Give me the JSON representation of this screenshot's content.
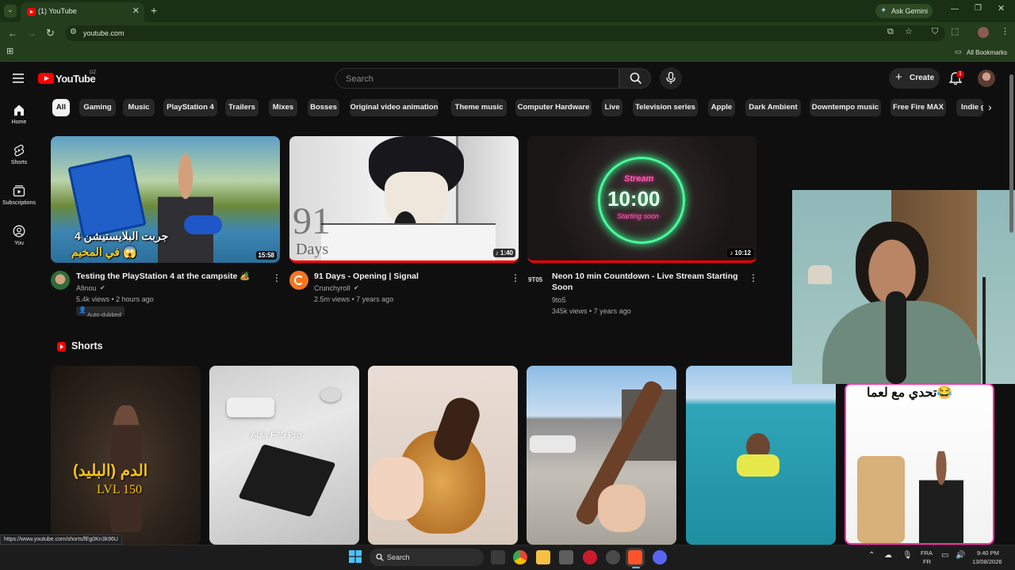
{
  "browser": {
    "tab_title": "(1) YouTube",
    "new_tab": "+",
    "url": "youtube.com",
    "ask_gemini": "Ask Gemini",
    "all_bookmarks": "All Bookmarks",
    "status_url": "https://www.youtube.com/shorts/fEg0Kn3k96U",
    "accent_color": "#243d1c"
  },
  "header": {
    "logo_text": "YouTube",
    "region": "DZ",
    "search_placeholder": "Search",
    "create_label": "Create",
    "notification_count": "1"
  },
  "sidebar": {
    "items": [
      {
        "label": "Home",
        "icon": "home-icon"
      },
      {
        "label": "Shorts",
        "icon": "shorts-icon"
      },
      {
        "label": "Subscriptions",
        "icon": "subscriptions-icon"
      },
      {
        "label": "You",
        "icon": "you-icon"
      }
    ]
  },
  "chips": [
    "All",
    "Gaming",
    "Music",
    "PlayStation 4",
    "Trailers",
    "Mixes",
    "Bosses",
    "Original video animation",
    "Theme music",
    "Computer Hardware",
    "Live",
    "Television series",
    "Apple",
    "Dark Ambient",
    "Downtempo music",
    "Free Fire MAX",
    "Indie g"
  ],
  "videos": [
    {
      "title": "Testing the PlayStation 4 at the campsite 🏕️",
      "channel": "Afinou",
      "meta": "5.4k views • 2 hours ago",
      "badge": "Auto-dubbed",
      "duration": "15:58",
      "thumb_text_1": "جربت البلايستيشن 4",
      "thumb_text_2": "في المخيم 😱"
    },
    {
      "title": "91 Days - Opening | Signal",
      "channel": "Crunchyroll",
      "meta": "2.5m views • 7 years ago",
      "duration": "♪ 1:40",
      "thumb_text_1": "91",
      "thumb_text_2": "Days"
    },
    {
      "title_line1": "Neon 10 min Countdown - Live Stream Starting",
      "title_line2": "Soon",
      "channel": "9to5",
      "avatar_text": "9T05",
      "meta": "345k views • 7 years ago",
      "duration": "♪ 10:12",
      "thumb_text_1": "Stream",
      "thumb_text_2": "10:00",
      "thumb_text_3": "Starting soon"
    }
  ],
  "shorts": {
    "section_title": "Shorts",
    "items": [
      {
        "caption_1": "الدم (البليد)",
        "caption_2": "LVL 150"
      },
      {
        "caption_1": "Aula F75 Pro"
      },
      {
        "caption_1": ""
      },
      {
        "caption_1": ""
      },
      {
        "caption_1": ""
      },
      {
        "caption_1": "تحدي مع لعما😂"
      }
    ]
  },
  "taskbar": {
    "search_label": "Search",
    "lang_1": "FRA",
    "lang_2": "FR",
    "time": "9:40 PM",
    "date": "13/08/2026"
  }
}
